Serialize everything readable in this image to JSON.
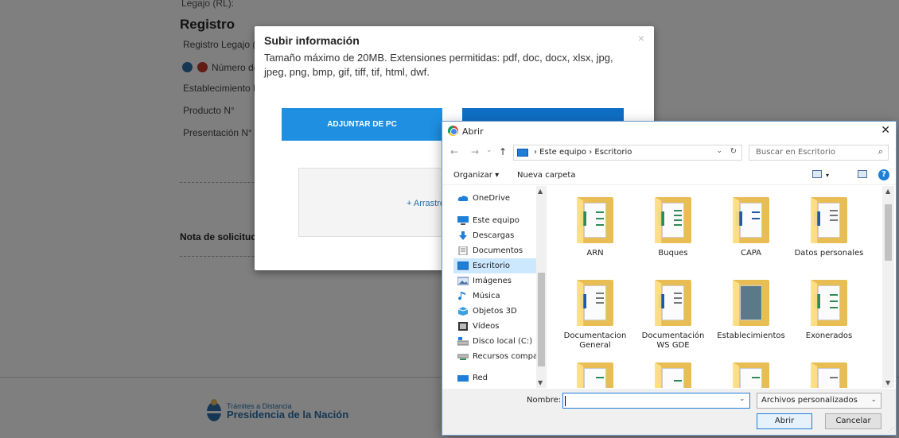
{
  "background_page": {
    "truncated_label": "Legajo (RL):",
    "section_title": "Registro",
    "fields": [
      "Registro Legajo (RL",
      "Número de",
      "Establecimiento N°",
      "Producto N°",
      "Presentación N°"
    ],
    "nota_label": "Nota de solicitud",
    "footer": {
      "subtitle": "Trámites a Distancia",
      "title": "Presidencia de la Nación"
    }
  },
  "modal": {
    "title": "Subir información",
    "close_glyph": "×",
    "description": "Tamaño máximo de 20MB. Extensiones permitidas: pdf, doc, docx, xlsx, jpg, jpeg, png, bmp, gif, tiff, tif, html, dwf.",
    "attach_button": "ADJUNTAR DE PC",
    "drop_text": "+ Arrastre"
  },
  "dialog": {
    "title": "Abrir",
    "close_glyph": "✕",
    "nav": {
      "back": "←",
      "forward": "→",
      "dropdown": "⌄",
      "up": "↑"
    },
    "address_path": "›  Este equipo  ›  Escritorio",
    "address_drop": "⌄",
    "refresh_glyph": "↻",
    "search_placeholder": "Buscar en Escritorio",
    "search_glyph": "⌕",
    "toolbar": {
      "organize": "Organizar ▾",
      "new_folder": "Nueva carpeta",
      "help": "?"
    },
    "nav_items": [
      {
        "label": "OneDrive",
        "icon": "cloud-icon"
      },
      {
        "label": "Este equipo",
        "icon": "computer-icon"
      },
      {
        "label": "Descargas",
        "icon": "download-icon"
      },
      {
        "label": "Documentos",
        "icon": "documents-icon"
      },
      {
        "label": "Escritorio",
        "icon": "desktop-icon",
        "selected": true
      },
      {
        "label": "Imágenes",
        "icon": "images-icon"
      },
      {
        "label": "Música",
        "icon": "music-icon"
      },
      {
        "label": "Objetos 3D",
        "icon": "cube-icon"
      },
      {
        "label": "Vídeos",
        "icon": "video-icon"
      },
      {
        "label": "Disco local (C:)",
        "icon": "disk-icon"
      },
      {
        "label": "Recursos compa",
        "icon": "network-drive-icon"
      },
      {
        "label": "Red",
        "icon": "network-icon"
      }
    ],
    "folders": [
      {
        "label": "ARN"
      },
      {
        "label": "Buques"
      },
      {
        "label": "CAPA"
      },
      {
        "label": "Datos personales"
      },
      {
        "label": "Documentacion General"
      },
      {
        "label": "Documentación WS GDE"
      },
      {
        "label": "Establecimientos"
      },
      {
        "label": "Exonerados"
      },
      {
        "label": ""
      },
      {
        "label": ""
      },
      {
        "label": ""
      },
      {
        "label": ""
      }
    ],
    "filename_label": "Nombre:",
    "filename_value": "",
    "filter_value": "Archivos personalizados",
    "open_button": "Abrir",
    "cancel_button": "Cancelar"
  },
  "colors": {
    "accent_blue": "#1e8fe1",
    "accent_dark_blue": "#0f6fc5",
    "folder_yellow": "#e8be54",
    "selection_blue": "#cce8ff"
  }
}
